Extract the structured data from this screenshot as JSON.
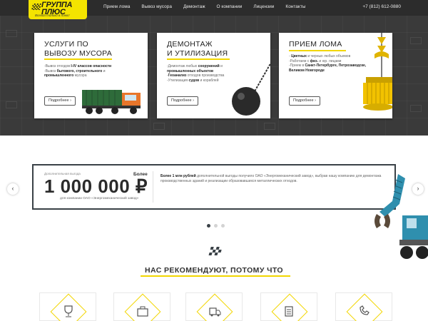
{
  "header": {
    "logo_title": "ГРУППА ПЛЮС",
    "logo_slogan": "Всегда только в плюс!",
    "nav": [
      "Прием лома",
      "Вывоз мусора",
      "Демонтаж",
      "О компании",
      "Лицензии",
      "Контакты"
    ],
    "phone": "+7 (812) 612-0880"
  },
  "cards": [
    {
      "title_line1": "УСЛУГИ ПО",
      "title_line2": "ВЫВОЗУ МУСОРА",
      "items": [
        {
          "pre": "-Вывоз отходов ",
          "bold": "I-IV классов опасности",
          "post": ""
        },
        {
          "pre": "-Вывоз ",
          "bold": "бытового, строительного",
          "post": " и"
        },
        {
          "pre": "",
          "bold": "промышленного",
          "post": " мусора"
        }
      ],
      "button": "Подробнее"
    },
    {
      "title_line1": "ДЕМОНТАЖ",
      "title_line2": "И УТИЛИЗАЦИЯ",
      "items": [
        {
          "pre": "-Демонтаж любых ",
          "bold": "сооружений",
          "post": " и"
        },
        {
          "pre": "",
          "bold": "промышленных объектов",
          "post": ""
        },
        {
          "pre": "-",
          "bold": "Геоанализ",
          "post": " отходов производства"
        },
        {
          "pre": "-Утилизация ",
          "bold": "судов",
          "post": " и кораблей"
        }
      ],
      "button": "Подробнее"
    },
    {
      "title_line1": "ПРИЕМ ЛОМА",
      "title_line2": "",
      "items": [
        {
          "pre": "- ",
          "bold": "Цветных",
          "post": " и черных любых объемов"
        },
        {
          "pre": "-Работаем с ",
          "bold": "физ.",
          "post": " и юр. лицами"
        },
        {
          "pre": "-Прием в ",
          "bold": "Санкт-Петербурге, Петрозаводске,",
          "post": ""
        },
        {
          "pre": "",
          "bold": "Великом Новгороде",
          "post": ""
        }
      ],
      "button": "Подробнее"
    }
  ],
  "slider": {
    "label_top": "Дополнительная выгода",
    "label_more": "Более",
    "big_number": "1 000 000 ₽",
    "label_bottom": "для компании ОАО «Энергомеханический завод»",
    "text_bold": "Более 1 млн рублей",
    "text_rest": " дополнительной выгоды получило ОАО «Энергомеханический завод», выбрав нашу компанию для демонтажа производственных зданий и реализации образовавшихся металлических отходов.",
    "prev_arrow": "‹",
    "next_arrow": "›",
    "active_dot": 0,
    "dot_count": 3
  },
  "recommend": {
    "title": "НАС РЕКОМЕНДУЮТ, ПОТОМУ ЧТО"
  },
  "colors": {
    "accent": "#f2d600",
    "dark": "#2c2c2c",
    "hero": "#3a3a3a"
  }
}
